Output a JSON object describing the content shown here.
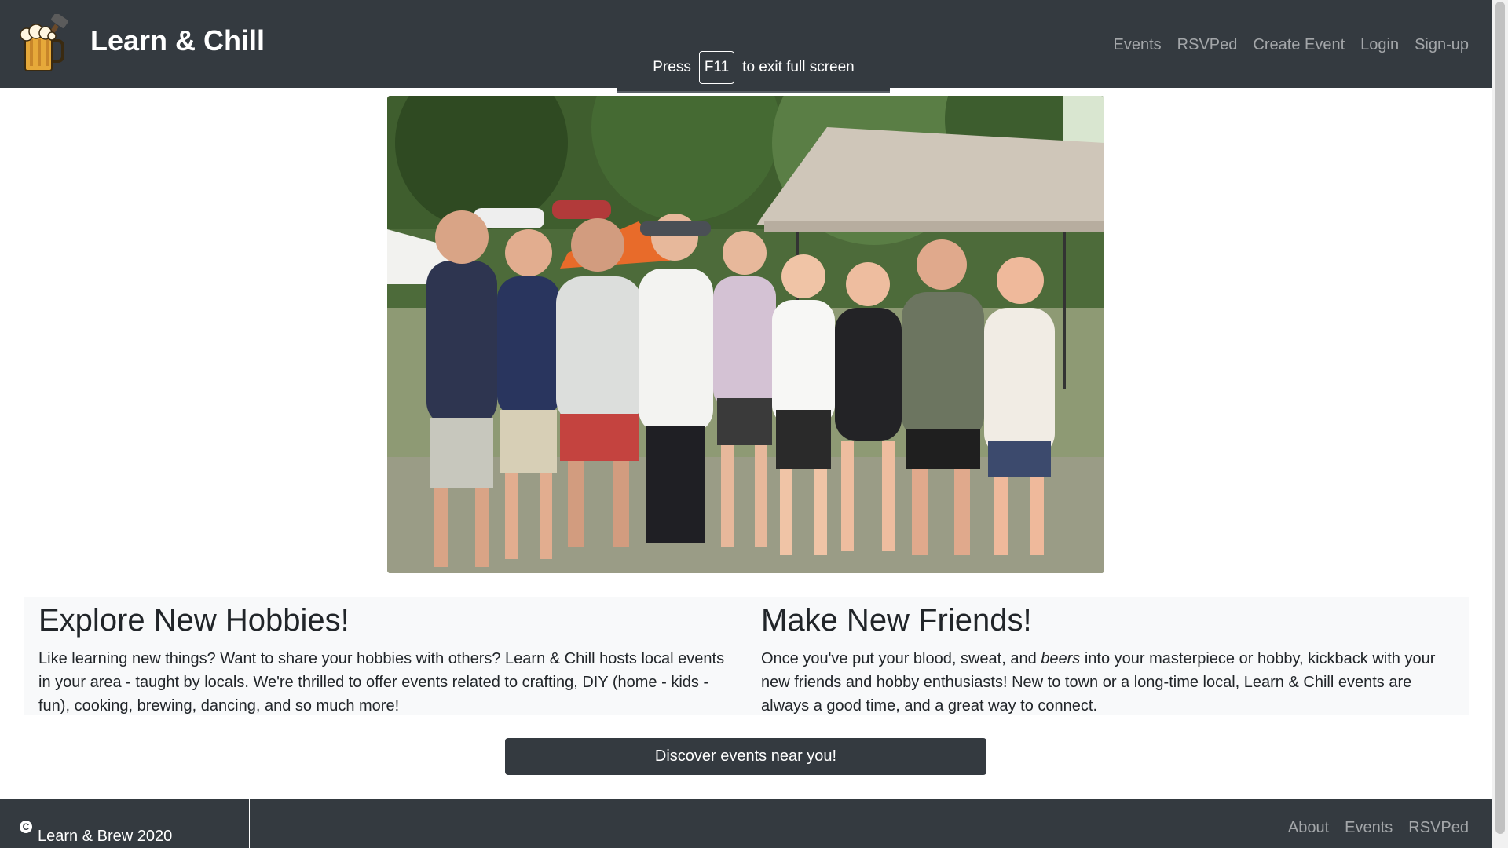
{
  "header": {
    "brand_name": "Learn & Chill",
    "logo_icon": "beer-mug-icon",
    "nav": [
      "Events",
      "RSVPed",
      "Create Event",
      "Login",
      "Sign-up"
    ]
  },
  "fullscreen_toast": {
    "prefix": "Press",
    "key": "F11",
    "suffix": "to exit full screen"
  },
  "hero": {
    "description": "Group photo of friends at an outdoor event"
  },
  "features": {
    "left": {
      "title": "Explore New Hobbies!",
      "body": "Like learning new things? Want to share your hobbies with others? Learn & Chill hosts local events in your area - taught by locals. We're thrilled to offer events related to crafting, DIY (home - kids - fun), cooking, brewing, dancing, and so much more!"
    },
    "right": {
      "title": "Make New Friends!",
      "body_before": "Once you've put your blood, sweat, and ",
      "body_em": "beers",
      "body_after": " into your masterpiece or hobby, kickback with your new friends and hobby enthusiasts! New to town or a long-time local, Learn & Chill events are always a good time, and a great way to connect."
    }
  },
  "cta": {
    "label": "Discover events near you!"
  },
  "footer": {
    "copyright_icon": "copyright-icon",
    "copyright_text": "Learn & Brew 2020",
    "links": [
      "About",
      "Events",
      "RSVPed"
    ]
  },
  "colors": {
    "navbar_bg": "#343a40",
    "panel_bg": "#f8f9fa",
    "nav_link": "rgba(255,255,255,0.55)"
  }
}
